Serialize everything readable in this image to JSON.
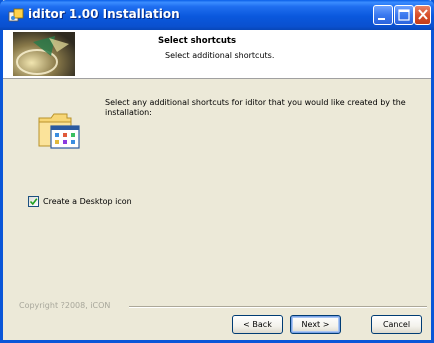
{
  "window": {
    "title": "iditor 1.00 Installation",
    "controls": [
      "minimize",
      "maximize",
      "close"
    ]
  },
  "header": {
    "title": "Select shortcuts",
    "subtitle": "Select additional shortcuts."
  },
  "body": {
    "instruction": "Select any additional shortcuts for iditor that you would like created by the installation:",
    "options": [
      {
        "label": "Create a Desktop icon",
        "checked": true
      }
    ]
  },
  "footer": {
    "copyright": "Copyright ?2008, iCON",
    "back_label": "< Back",
    "next_label": "Next >",
    "cancel_label": "Cancel"
  },
  "colors": {
    "titlebar": "#0a58dd",
    "dialog_bg": "#ece9d8",
    "button_border": "#003c74"
  },
  "icons": [
    "installer-app-icon",
    "header-disc-art",
    "folder-shortcut-icon",
    "checkmark-icon"
  ]
}
